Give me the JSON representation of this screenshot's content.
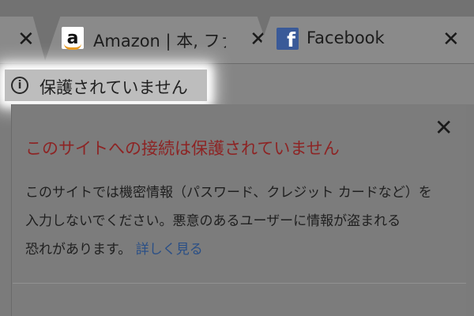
{
  "tabs": [
    {
      "title": "",
      "close": "✕"
    },
    {
      "title": "Amazon | 本, ファ",
      "icon": "amazon-icon",
      "close": "✕"
    },
    {
      "title": "Facebook",
      "icon": "facebook-icon",
      "close": "✕"
    }
  ],
  "address": {
    "icon": "info-icon",
    "status": "保護されていません"
  },
  "bubble": {
    "title": "このサイトへの接続は保護されていません",
    "body_lines": [
      "このサイトでは機密情報（パスワード、クレジット カードなど）を",
      "入力しないでください。悪意のあるユーザーに情報が盗まれる",
      "恐れがあります。"
    ],
    "link": "詳しく見る",
    "close": "✕"
  },
  "colors": {
    "title_red": "#8d2424",
    "link_blue": "#2a4f86",
    "facebook_blue": "#3a5a98",
    "amazon_orange": "#e6961a"
  }
}
